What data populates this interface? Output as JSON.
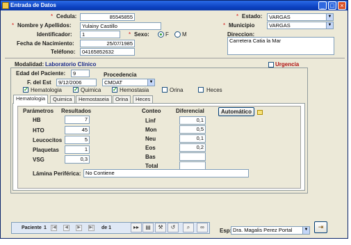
{
  "window": {
    "title": "Entrada de Datos"
  },
  "patient": {
    "cedula_label": "Cedula:",
    "cedula_value": "85545855",
    "nombre_label": "Nombre y Apellidos:",
    "nombre_value": "Yulainy Castillo",
    "identificador_label": "Identificador:",
    "identificador_value": "1",
    "sexo_label": "Sexo:",
    "sexo_f_label": "F",
    "sexo_m_label": "M",
    "sexo_selected": "F",
    "fecha_label": "Fecha de Nacimiento:",
    "fecha_value": "25/07/1985",
    "telefono_label": "Teléfono:",
    "telefono_value": "04165852632",
    "estado_label": "Estado:",
    "estado_value": "VARGAS",
    "municipio_label": "Municipio",
    "municipio_value": "VARGAS",
    "direccion_label": "Direccion:",
    "direccion_value": "Carretera Catia la Mar",
    "required_mark": "*"
  },
  "modalidad": {
    "label": "Modalidad:",
    "value": "Laboratorio Clínico",
    "urgencia_label": "Urgencia"
  },
  "study": {
    "edad_label": "Edad del Paciente:",
    "edad_value": "9",
    "fecha_label": "F. del Est",
    "fecha_value": "9/12/2006",
    "procedencia_label": "Procedencia",
    "procedencia_value": "CMDAT",
    "checks": [
      {
        "label": "Hematologia",
        "checked": true
      },
      {
        "label": "Quimica",
        "checked": true
      },
      {
        "label": "Hemostasia",
        "checked": true
      },
      {
        "label": "Orina",
        "checked": false
      },
      {
        "label": "Heces",
        "checked": false
      }
    ]
  },
  "tabs": [
    "Hematologia",
    "Quimica",
    "Hemostaseia",
    "Orina",
    "Heces"
  ],
  "hematologia": {
    "parametros_header": "Parámetros",
    "resultados_header": "Resultados",
    "params": [
      {
        "label": "HB",
        "value": "7"
      },
      {
        "label": "HTO",
        "value": "45"
      },
      {
        "label": "Leucocitos",
        "value": "5"
      },
      {
        "label": "Plaquetas",
        "value": "1"
      },
      {
        "label": "VSG",
        "value": "0,3"
      }
    ],
    "conteo_header": "Conteo",
    "diferencial_header": "Diferencial",
    "diff": [
      {
        "label": "Linf",
        "value": "0,1"
      },
      {
        "label": "Mon",
        "value": "0,5"
      },
      {
        "label": "Neu",
        "value": "0,1"
      },
      {
        "label": "Eos",
        "value": "0,2"
      },
      {
        "label": "Bas",
        "value": ""
      },
      {
        "label": "Total",
        "value": ""
      }
    ],
    "automatico_label": "Automático",
    "lamina_label": "Lámina Periférica:",
    "lamina_value": "No Contiene"
  },
  "navigator": {
    "paciente_label": "Paciente",
    "current": "1",
    "of_label": "de 1"
  },
  "esp": {
    "label": "Esp:",
    "value": "Dra. Magalis Perez Portal"
  },
  "colors": {
    "titlebar": "#0a3fbe",
    "modalidad_text": "#1a2a8a",
    "urgencia_text": "#b01010",
    "required": "#d61010"
  },
  "icons": {
    "window": "app-icon",
    "minimize": "minimize-icon",
    "maximize": "maximize-icon",
    "close": "close-icon",
    "nav_first": "first-record-icon",
    "nav_prev": "previous-record-icon",
    "nav_next": "next-record-icon",
    "nav_last": "last-record-icon",
    "exit": "exit-door-icon"
  }
}
